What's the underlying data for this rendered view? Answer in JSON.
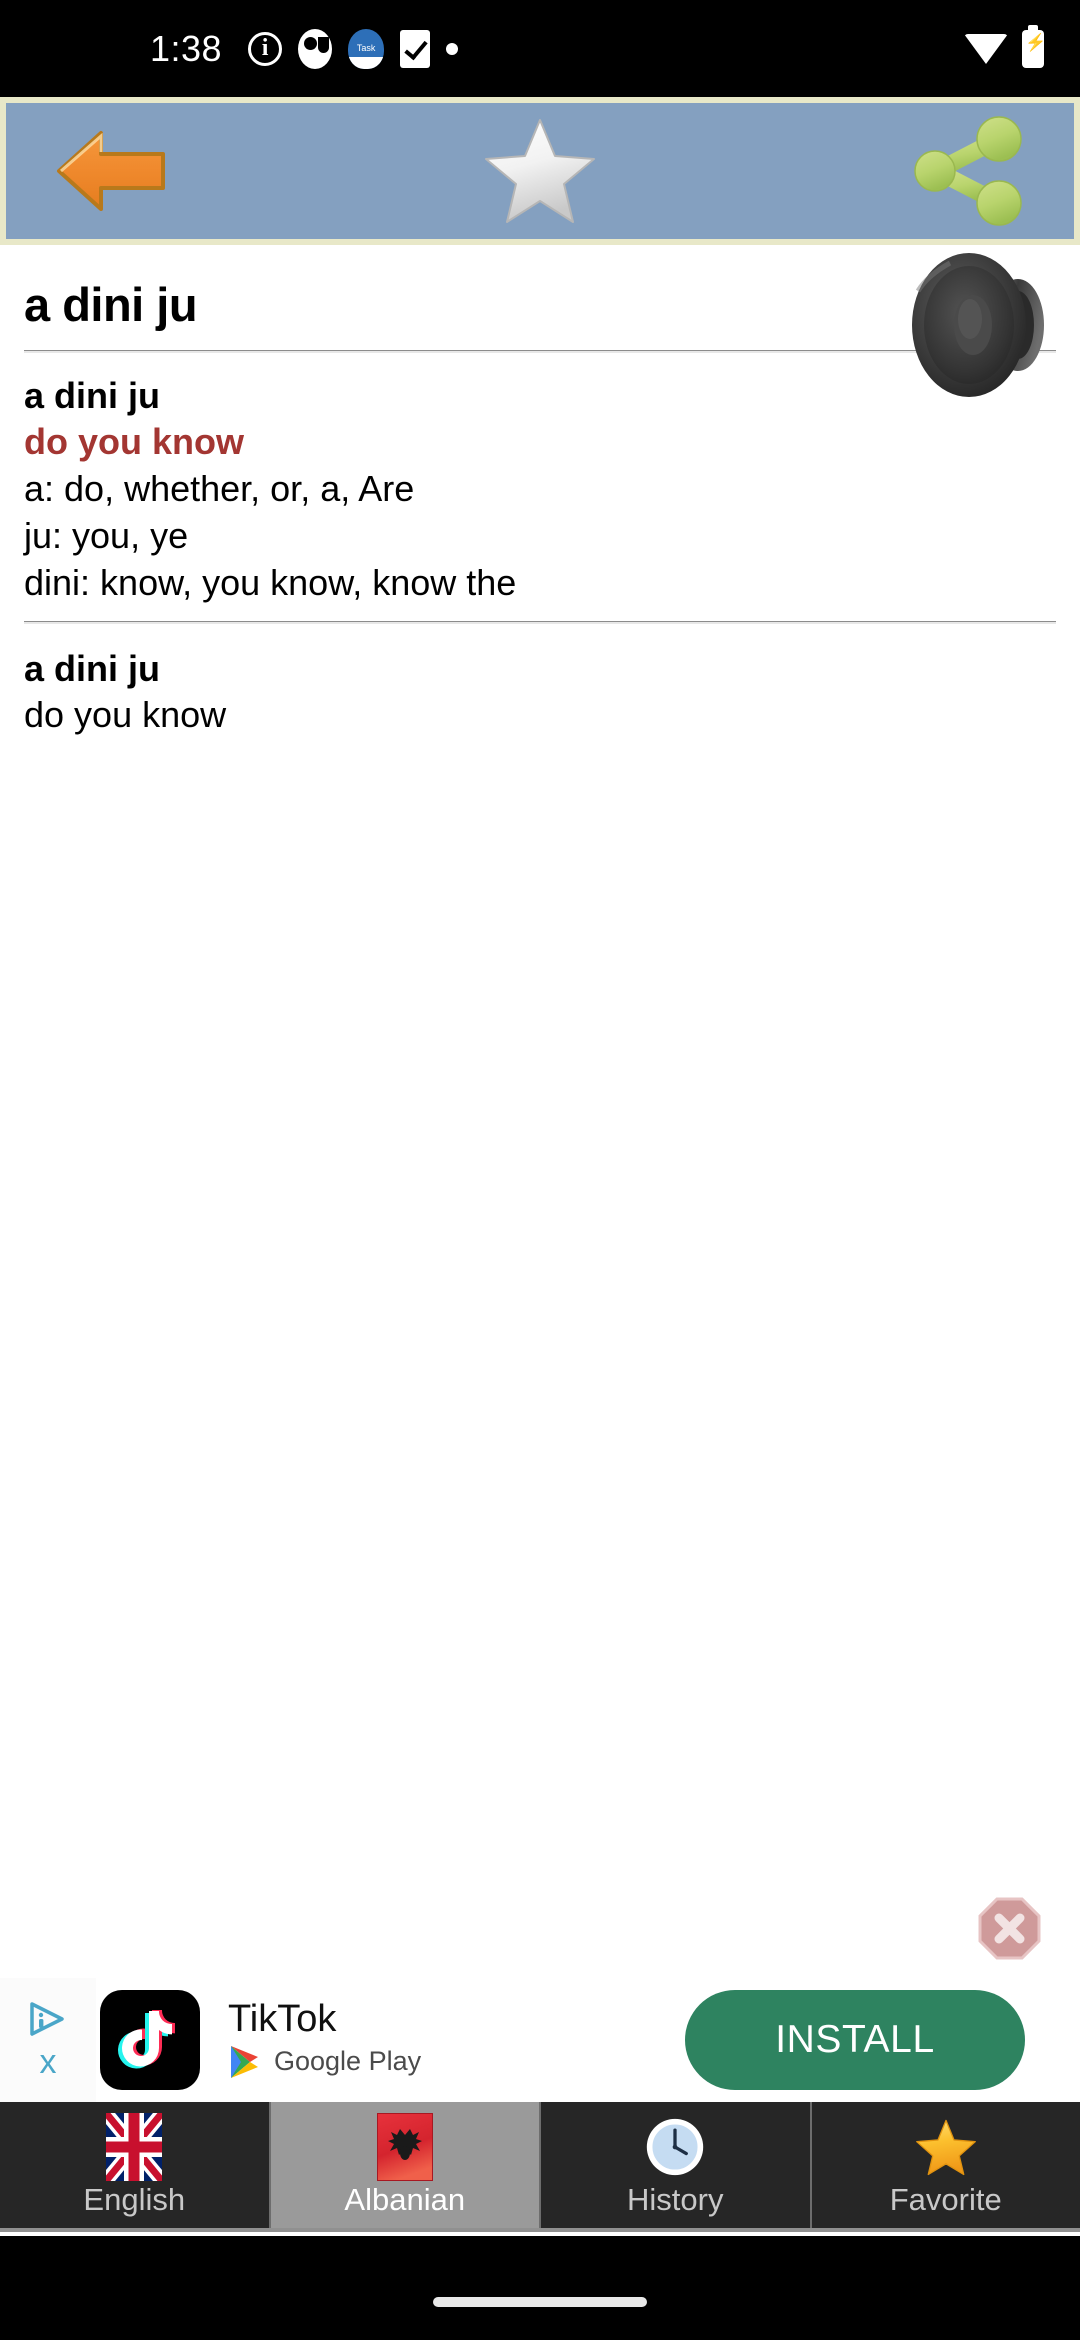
{
  "status_bar": {
    "time": "1:38",
    "left_icons": [
      "info-icon",
      "notification-blob-icon",
      "app-badge-icon",
      "checklist-icon",
      "dot-icon"
    ],
    "right_icons": [
      "wifi-icon",
      "battery-charging-icon"
    ]
  },
  "toolbar": {
    "background": "#84a0c0",
    "border_color": "#e8e8c8",
    "back_label": "Back",
    "favorite_label": "Favorite",
    "share_label": "Share"
  },
  "entry": {
    "headword": "a dini ju",
    "speaker_label": "Pronounce",
    "definition": {
      "term": "a dini ju",
      "translation": "do you know",
      "translation_color": "#a33632",
      "breakdown": [
        "a: do, whether, or, a, Are",
        "ju: you, ye",
        "dini: know, you know, know the"
      ]
    },
    "example": {
      "term": "a dini ju",
      "translation": "do you know"
    }
  },
  "ad": {
    "close_label": "Close ad",
    "adchoices_label": "AdChoices",
    "dismiss_label": "x",
    "app_name": "TikTok",
    "store": "Google Play",
    "cta": "INSTALL",
    "cta_color": "#2e8360"
  },
  "bottom_nav": {
    "items": [
      {
        "label": "English",
        "icon": "uk-flag-icon",
        "active": false
      },
      {
        "label": "Albanian",
        "icon": "albania-flag-icon",
        "active": true
      },
      {
        "label": "History",
        "icon": "clock-icon",
        "active": false
      },
      {
        "label": "Favorite",
        "icon": "star-icon",
        "active": false
      }
    ]
  }
}
